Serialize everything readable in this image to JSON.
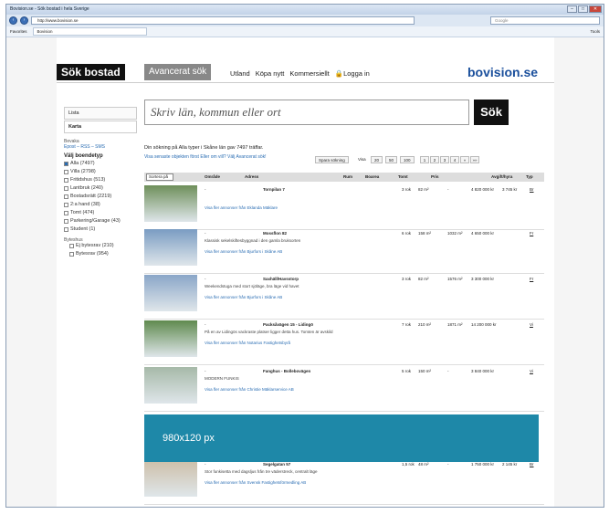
{
  "browser": {
    "title": "Bovision.se - Sök bostad i hela Sverige",
    "url": "http://www.bovision.se",
    "search_provider": "Google",
    "favorites": "Favorites",
    "fav_tab": "Bovision",
    "tools": "Tools"
  },
  "header": {
    "tab_active": "Sök bostad",
    "tab_advanced": "Avancerat sök",
    "links": [
      "Utland",
      "Köpa nytt",
      "Kommersiellt",
      "Logga in"
    ],
    "logo": "bovision.se"
  },
  "sidebar": {
    "list": "Lista",
    "map": "Karta",
    "bevaka": "Bevaka",
    "feeds": "Epost – RSS – SMS",
    "type_heading": "Välj boendetyp",
    "types": [
      {
        "label": "Alla (7497)",
        "checked": true
      },
      {
        "label": "Villa (2798)",
        "checked": false
      },
      {
        "label": "Fritidshus (513)",
        "checked": false
      },
      {
        "label": "Lantbruk (240)",
        "checked": false
      },
      {
        "label": "Bostadsrätt (2219)",
        "checked": false
      },
      {
        "label": "2:a hand (38)",
        "checked": false
      },
      {
        "label": "Tomt (474)",
        "checked": false
      },
      {
        "label": "Parkering/Garage (43)",
        "checked": false
      },
      {
        "label": "Student (1)",
        "checked": false
      }
    ],
    "bytes_heading": "Byteshus",
    "bytes": [
      "Ej bytesrav (210)",
      "Bytesrav (954)"
    ]
  },
  "search": {
    "placeholder": "Skriv län, kommun eller ort",
    "button": "Sök"
  },
  "results": {
    "info": "Din sökning på Alla typer i Skåne län gav 7497 träffar.",
    "links": "Visa senaste objekten först   Eller om vill? Välj Avancerat sök!",
    "save": "Spara sökning",
    "show": "Visa",
    "per_page": [
      "20",
      "50",
      "100"
    ],
    "pages": [
      "1",
      "2",
      "3",
      "4",
      "»",
      "»»"
    ]
  },
  "table": {
    "sort": "Sortera på",
    "cols": [
      "Område",
      "Adress",
      "Rum",
      "Boarea",
      "Tomt",
      "Pris",
      "Avgift/hyra",
      "Typ"
    ]
  },
  "rows": [
    {
      "area": "-",
      "address": "Tornpilan 7",
      "rooms": "3 rok",
      "size": "82 m²",
      "plot": "-",
      "price": "4 820 000 kr",
      "fee": "3 745 kr",
      "type": "Br",
      "desc": "",
      "link": "Visa fler annonser från Eklanda Mäklare"
    },
    {
      "area": "-",
      "address": "Mossflon 82",
      "rooms": "6 rok",
      "size": "158 m²",
      "plot": "1032 m²",
      "price": "4 650 000 kr",
      "fee": "",
      "type": "Fr",
      "desc": "Klassisk sekelskiftesbyggnad i den gamla bruksorten",
      "link": "Visa fler annonser från Bjurfors i Skåne AB"
    },
    {
      "area": "-",
      "address": "Saxhäll/Havsstorp",
      "rooms": "3 rok",
      "size": "82 m²",
      "plot": "1576 m²",
      "price": "3 300 000 kr",
      "fee": "",
      "type": "Fr",
      "desc": "Weekendstuga med stort sjöläge, bra läge vid havet",
      "link": "Visa fler annonser från Bjurfors i Skåne AB"
    },
    {
      "area": "-",
      "address": "Packsåvägen 15 - Lidingö",
      "rooms": "7 rok",
      "size": "210 m²",
      "plot": "1871 m²",
      "price": "14 200 000 kr",
      "fee": "",
      "type": "Vi",
      "desc": "På en av Lidingös vackraste platser ligger detta hus. Tomten är avskild",
      "link": "Visa fler annonser från Notarius Fastighetsbyrå"
    },
    {
      "area": "-",
      "address": "Fanghus - Bollebovägen",
      "rooms": "5 rok",
      "size": "150 m²",
      "plot": "-",
      "price": "3 840 000 kr",
      "fee": "",
      "type": "Vi",
      "desc": "MODERN FUNKIS",
      "link": "Visa fler annonser från Christie Mäklarservice AB"
    },
    {
      "area": "-",
      "address": "Segelgatan 57",
      "rooms": "1,5 rok",
      "size": "48 m²",
      "plot": "-",
      "price": "1 750 000 kr",
      "fee": "2 145 kr",
      "type": "Br",
      "desc": "Stor funkisetta med dagsljus från tre väderstreck, centralt läge",
      "link": "Visa fler annonser från Svensk Fastighetsförmedling AB"
    }
  ],
  "ad": "980x120 px"
}
